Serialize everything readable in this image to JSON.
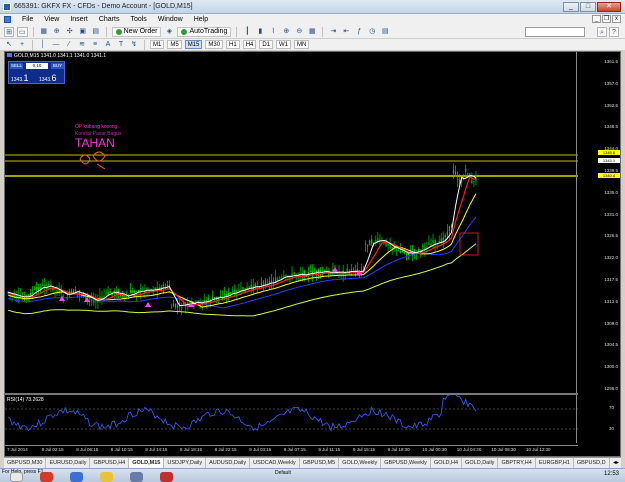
{
  "window": {
    "title": "665391: GKFX FX - CFDs - Demo Account - [GOLD,M15]",
    "buttons": [
      "_",
      "□",
      "✕"
    ]
  },
  "menu": {
    "items": [
      "File",
      "View",
      "Insert",
      "Charts",
      "Tools",
      "Window",
      "Help"
    ],
    "mdi_buttons": [
      "_",
      "❐",
      "x"
    ]
  },
  "toolbar1": {
    "new_order_label": "New Order",
    "autotrading_label": "AutoTrading"
  },
  "toolbar2": {
    "timeframes": [
      "M1",
      "M5",
      "M15",
      "M30",
      "H1",
      "H4",
      "D1",
      "W1",
      "MN"
    ],
    "active_timeframe": "M15"
  },
  "chart": {
    "header": "GOLD,M15  1341.0 1341.1 1341.0 1341.1",
    "one_click": {
      "sell_label": "SELL",
      "buy_label": "BUY",
      "lot": "0.10",
      "sell_price_small": "1343",
      "sell_price_big": "1",
      "buy_price_small": "1343",
      "buy_price_big": "6"
    },
    "annotations": {
      "line1": "OP kubang kosong",
      "line2": "Kondisi Pasar Bagus",
      "line3": "TAHAN"
    },
    "price_labels": [
      "1361.5",
      "1357.0",
      "1352.5",
      "1348.5",
      "1344.0",
      "1339.5",
      "1335.0",
      "1331.0",
      "1326.5",
      "1322.0",
      "1317.5",
      "1313.5",
      "1309.0",
      "1304.5",
      "1300.0",
      "1296.0"
    ],
    "price_tags": [
      {
        "text": "1345.8",
        "color": "#ffff00"
      },
      {
        "text": "1343.1",
        "color": "#ffffff"
      },
      {
        "text": "1340.4",
        "color": "#ffff00"
      }
    ],
    "time_labels": [
      "7 Jul 2014",
      "8 Jul 02:15",
      "8 Jul 06:15",
      "8 Jul 10:15",
      "8 Jul 14:15",
      "8 Jul 18:15",
      "8 Jul 22:15",
      "9 Jul 03:15",
      "9 Jul 07:15",
      "9 Jul 11:15",
      "9 Jul 15:15",
      "9 Jul 19:30",
      "10 Jul 00:30",
      "10 Jul 04:30",
      "10 Jul 08:30",
      "10 Jul 12:30"
    ],
    "rsi_label": "RSI(14) 73.2628",
    "rsi_ticks": [
      "70",
      "30"
    ],
    "colors": {
      "candle": "#00d000",
      "ma_fast": "#ffffff",
      "ma_red": "#ff2020",
      "ma_yellow": "#ffff00",
      "ma_blue": "#2040ff",
      "ma_slow": "#c8ff40",
      "signal": "#ff40ff",
      "rsi_line": "#3060ff"
    }
  },
  "tabs": {
    "items": [
      "GBPUSD,M30",
      "EURUSD,Daily",
      "GBPUSD,H4",
      "GOLD,M15",
      "USDJPY,Daily",
      "AUDUSD,Daily",
      "USDCAD,Weekly",
      "GBPUSD,M5",
      "GOLD,Weekly",
      "GBPUSD,Weekly",
      "GOLD,H4",
      "GOLD,Daily",
      "GBPTRY,H4",
      "EURGBP,H1",
      "GBPUSD,D"
    ],
    "active": "GOLD,M15"
  },
  "status": {
    "help_text": "For Help, press F1",
    "profile": "Default",
    "clock": "12:53"
  }
}
